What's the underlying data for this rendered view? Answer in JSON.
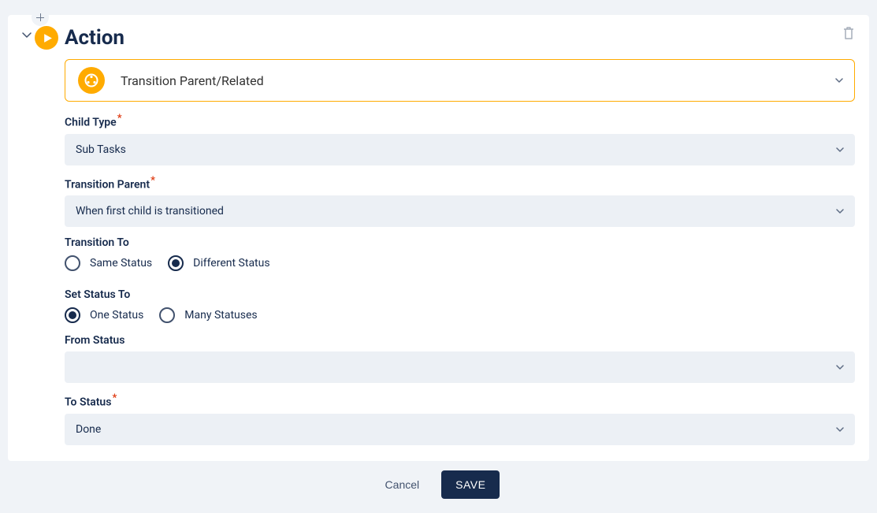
{
  "panel": {
    "title": "Action",
    "actionType": "Transition Parent/Related"
  },
  "fields": {
    "childType": {
      "label": "Child Type",
      "required": true,
      "value": "Sub Tasks"
    },
    "transitionParent": {
      "label": "Transition Parent",
      "required": true,
      "value": "When first child is transitioned"
    },
    "transitionTo": {
      "label": "Transition To",
      "options": {
        "same": "Same Status",
        "different": "Different Status"
      },
      "selected": "different"
    },
    "setStatusTo": {
      "label": "Set Status To",
      "options": {
        "one": "One Status",
        "many": "Many Statuses"
      },
      "selected": "one"
    },
    "fromStatus": {
      "label": "From Status",
      "required": false,
      "value": ""
    },
    "toStatus": {
      "label": "To Status",
      "required": true,
      "value": "Done"
    }
  },
  "footer": {
    "cancel": "Cancel",
    "save": "SAVE"
  }
}
